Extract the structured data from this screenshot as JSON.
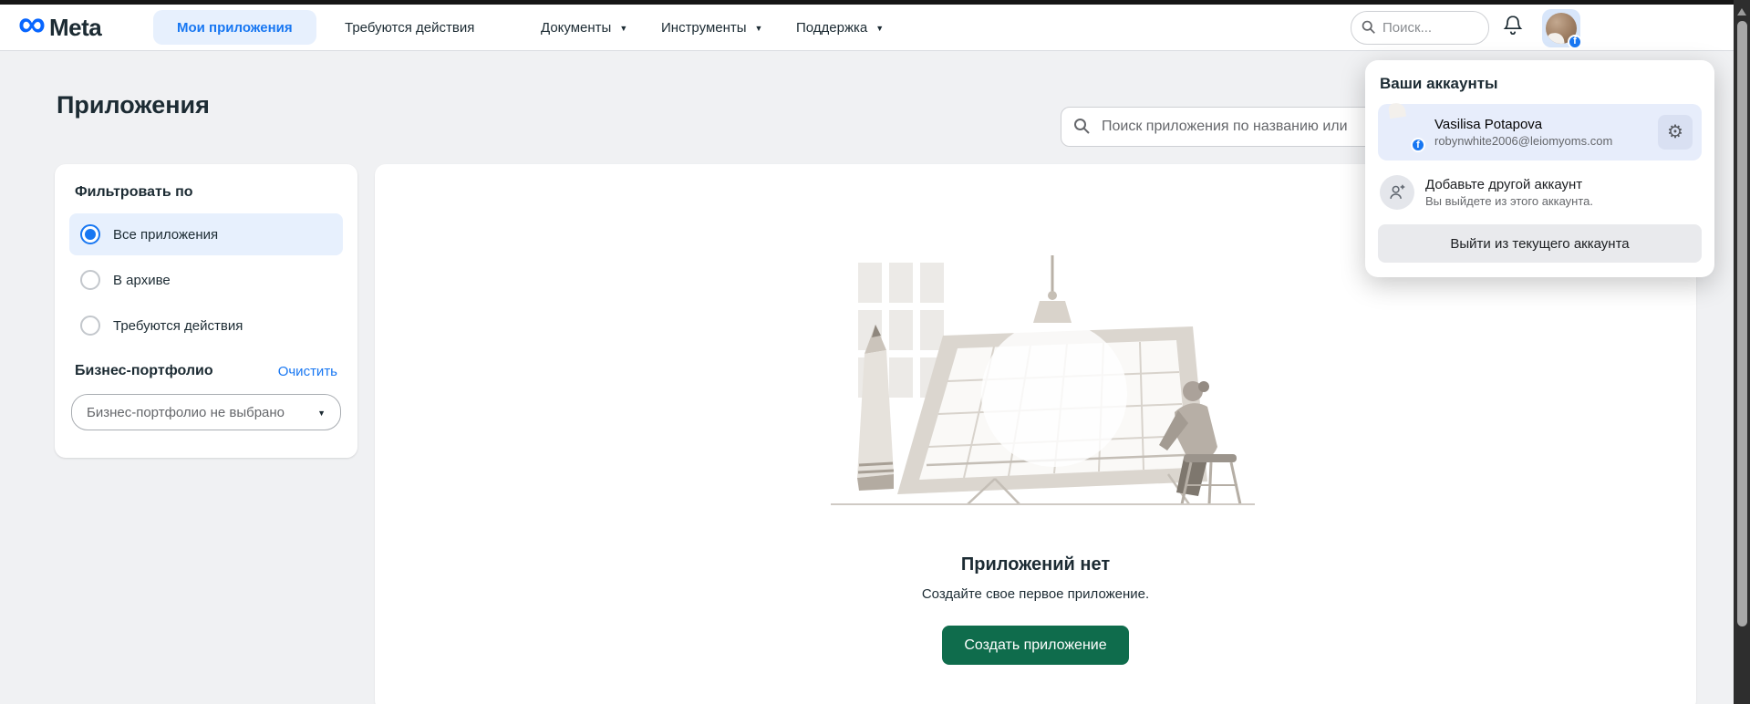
{
  "nav": {
    "logo_text": "Meta",
    "active_tab": "Мои приложения",
    "items": [
      {
        "label": "Требуются действия",
        "has_caret": false
      },
      {
        "label": "Документы",
        "has_caret": true
      },
      {
        "label": "Инструменты",
        "has_caret": true
      },
      {
        "label": "Поддержка",
        "has_caret": true
      }
    ],
    "search_placeholder": "Поиск..."
  },
  "page": {
    "title": "Приложения",
    "search_placeholder": "Поиск приложения по названию или"
  },
  "filters": {
    "title": "Фильтровать по",
    "options": [
      {
        "label": "Все приложения",
        "selected": true
      },
      {
        "label": "В архиве",
        "selected": false
      },
      {
        "label": "Требуются действия",
        "selected": false
      }
    ],
    "portfolio_label": "Бизнес-портфолио",
    "clear_label": "Очистить",
    "portfolio_select_value": "Бизнес-портфолио не выбрано"
  },
  "empty_state": {
    "title": "Приложений нет",
    "subtitle": "Создайте свое первое приложение.",
    "button_label": "Создать приложение"
  },
  "account_menu": {
    "title": "Ваши аккаунты",
    "account": {
      "name": "Vasilisa Potapova",
      "email": "robynwhite2006@leiomyoms.com"
    },
    "add_account": {
      "title": "Добавьте другой аккаунт",
      "subtitle": "Вы выйдете из этого аккаунта."
    },
    "logout_label": "Выйти из текущего аккаунта"
  },
  "icons": {
    "meta_logo_glyph": "∞",
    "caret_down_glyph": "▼",
    "gear_glyph": "⚙",
    "fb_badge_glyph": "f"
  },
  "colors": {
    "accent_blue": "#1877F2",
    "active_tab_bg": "#E7F0FD",
    "selected_filter_bg": "#E7F0FD",
    "account_row_bg": "#E7EDFB",
    "create_button_green": "#0F6C4C",
    "page_bg": "#F0F1F3",
    "top_strip": "#161616",
    "scrollbar_track": "#2E2E2E",
    "scrollbar_thumb": "#A8A8A8",
    "facebook_blue": "#1877F2"
  }
}
